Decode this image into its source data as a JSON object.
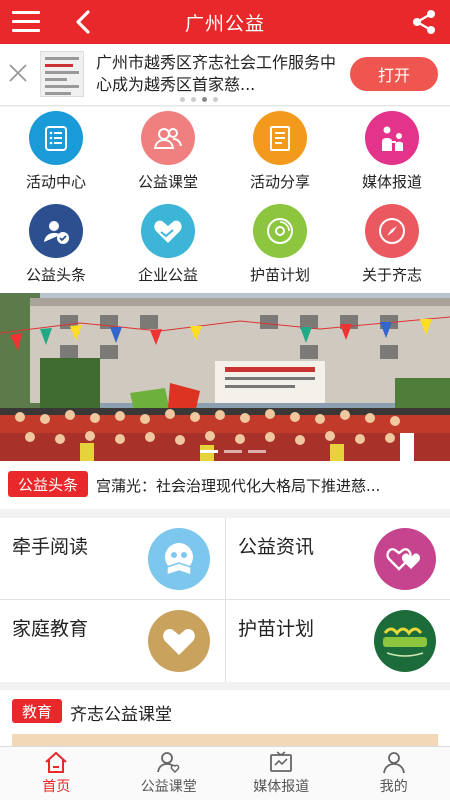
{
  "header": {
    "title": "广州公益"
  },
  "promo": {
    "text": "广州市越秀区齐志社会工作服务中心成为越秀区首家慈...",
    "open_label": "打开"
  },
  "grid": [
    {
      "label": "活动中心",
      "icon": "list-doc-icon",
      "color": "#1a9ad6"
    },
    {
      "label": "公益课堂",
      "icon": "people-icon",
      "color": "#f07f80"
    },
    {
      "label": "活动分享",
      "icon": "notebook-icon",
      "color": "#f39a1c"
    },
    {
      "label": "媒体报道",
      "icon": "family-icon",
      "color": "#e3338a"
    },
    {
      "label": "公益头条",
      "icon": "user-check-icon",
      "color": "#2b4f8f"
    },
    {
      "label": "企业公益",
      "icon": "handshake-heart-icon",
      "color": "#3db5d6"
    },
    {
      "label": "护苗计划",
      "icon": "disc-icon",
      "color": "#8cc63f"
    },
    {
      "label": "关于齐志",
      "icon": "compass-icon",
      "color": "#ea5960"
    }
  ],
  "ticker": {
    "tag": "公益头条",
    "text": "宫蒲光：社会治理现代化大格局下推进慈..."
  },
  "tiles": [
    {
      "label": "牵手阅读",
      "icon": "book-reader-icon",
      "color": "#7dc7ee"
    },
    {
      "label": "公益资讯",
      "icon": "hearts-icon",
      "color": "#c6448e"
    },
    {
      "label": "家庭教育",
      "icon": "heart-icon",
      "color": "#c9a35d"
    },
    {
      "label": "护苗计划",
      "icon": "seedling-logo-icon",
      "color": "#1c6b3a"
    }
  ],
  "section": {
    "tag": "教育",
    "title": "齐志公益课堂"
  },
  "tabs": [
    {
      "label": "首页",
      "icon": "home-icon",
      "active": true
    },
    {
      "label": "公益课堂",
      "icon": "class-icon",
      "active": false
    },
    {
      "label": "媒体报道",
      "icon": "media-icon",
      "active": false
    },
    {
      "label": "我的",
      "icon": "user-icon",
      "active": false
    }
  ]
}
